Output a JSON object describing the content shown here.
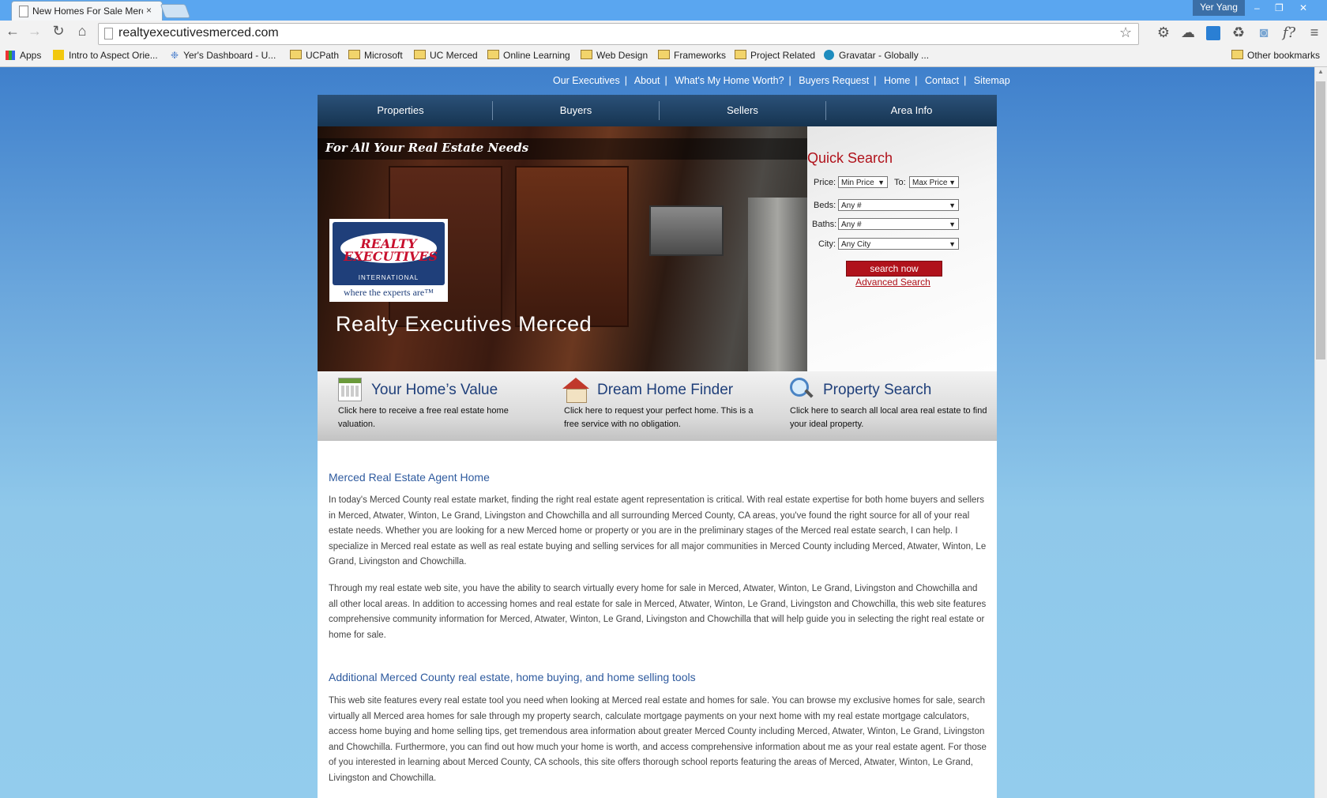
{
  "browser": {
    "tab_title": "New Homes For Sale Merced",
    "tab_close": "×",
    "user": "Yer Yang",
    "window_controls": [
      "–",
      "❐",
      "✕"
    ],
    "url": "realtyexecutivesmerced.com",
    "bookmarks": [
      {
        "label": "Apps",
        "type": "apps"
      },
      {
        "label": "Intro to Aspect Orie...",
        "type": "page"
      },
      {
        "label": "Yer's Dashboard - U...",
        "type": "page"
      },
      {
        "label": "UCPath",
        "type": "folder"
      },
      {
        "label": "Microsoft",
        "type": "folder"
      },
      {
        "label": "UC Merced",
        "type": "folder"
      },
      {
        "label": "Online Learning",
        "type": "folder"
      },
      {
        "label": "Web Design",
        "type": "folder"
      },
      {
        "label": "Frameworks",
        "type": "folder"
      },
      {
        "label": "Project Related",
        "type": "folder"
      },
      {
        "label": "Gravatar - Globally ...",
        "type": "page"
      }
    ],
    "other_bookmarks": "Other bookmarks"
  },
  "site": {
    "top_links": [
      "Our Executives",
      "About",
      "What's My Home Worth?",
      "Buyers Request",
      "Home",
      "Contact",
      "Sitemap"
    ],
    "nav": [
      "Properties",
      "Buyers",
      "Sellers",
      "Area Info"
    ],
    "hero": {
      "tagline": "For All Your Real Estate Needs",
      "logo_line1": "REALTY",
      "logo_line2": "EXECUTIVES",
      "logo_international": "INTERNATIONAL",
      "logo_slogan": "where the experts are™",
      "name": "Realty Executives Merced"
    },
    "quick_search": {
      "title": "Quick Search",
      "price_label": "Price:",
      "min_price": "Min Price",
      "to_label": "To:",
      "max_price": "Max Price",
      "beds_label": "Beds:",
      "beds_value": "Any #",
      "baths_label": "Baths:",
      "baths_value": "Any #",
      "city_label": "City:",
      "city_value": "Any City",
      "search_button": "search now",
      "advanced_link": "Advanced Search"
    },
    "features": [
      {
        "title": "Your Home’s Value",
        "desc": "Click here to receive a free real estate home valuation."
      },
      {
        "title": "Dream Home Finder",
        "desc": "Click here to request your perfect home. This is a free service with no obligation."
      },
      {
        "title": "Property Search",
        "desc": "Click here to search all local area real estate to find your ideal property."
      }
    ],
    "content": {
      "heading1": "Merced Real Estate Agent Home",
      "para1": "In today's Merced County real estate market, finding the right real estate agent representation is critical. With real estate expertise for both home buyers and sellers in Merced, Atwater, Winton, Le Grand, Livingston and Chowchilla and all surrounding Merced County, CA areas, you've found the right source for all of your real estate needs. Whether you are looking for a new Merced home or property or you are in the preliminary stages of the Merced real estate search, I can help. I specialize in Merced real estate as well as real estate buying and selling services for all major communities in Merced County including Merced, Atwater, Winton, Le Grand, Livingston and Chowchilla.",
      "para2": "Through my real estate web site, you have the ability to search virtually every home for sale in Merced, Atwater, Winton, Le Grand, Livingston and Chowchilla and all other local areas. In addition to accessing homes and real estate for sale in Merced, Atwater, Winton, Le Grand, Livingston and Chowchilla, this web site features comprehensive community information for Merced, Atwater, Winton, Le Grand, Livingston and Chowchilla that will help guide you in selecting the right real estate or home for sale.",
      "heading2": "Additional Merced County real estate, home buying, and home selling tools",
      "para3": "This web site features every real estate tool you need when looking at Merced real estate and homes for sale. You can browse my exclusive homes for sale, search virtually all Merced area homes for sale through my property search, calculate mortgage payments on your next home with my real estate mortgage calculators, access home buying and home selling tips, get tremendous area information about greater Merced County including Merced, Atwater, Winton, Le Grand, Livingston and Chowchilla. Furthermore, you can find out how much your home is worth, and access comprehensive information about me as your real estate agent. For those of you interested in learning about Merced County, CA schools, this site offers thorough school reports featuring the areas of Merced, Atwater, Winton, Le Grand, Livingston and Chowchilla."
    }
  }
}
